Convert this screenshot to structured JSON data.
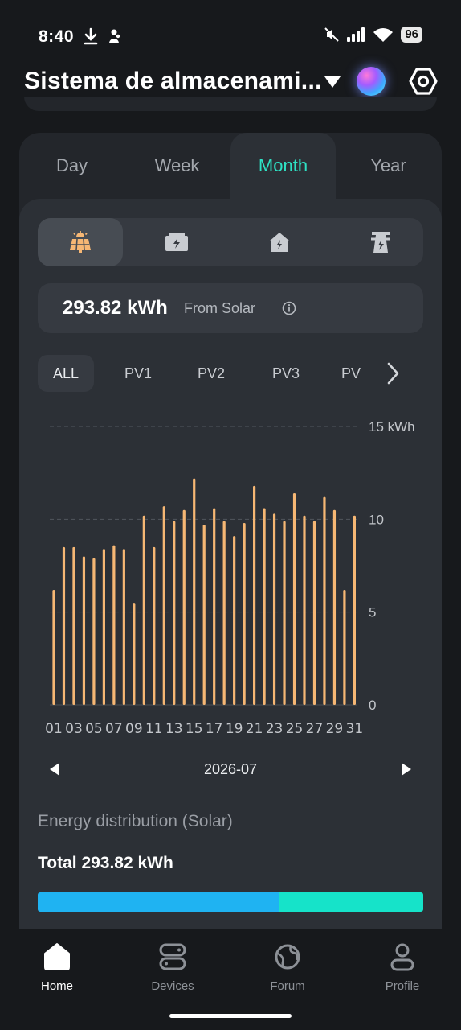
{
  "status": {
    "time": "8:40",
    "battery": "96"
  },
  "header": {
    "title": "Sistema de almacenami..."
  },
  "period_tabs": [
    {
      "label": "Day"
    },
    {
      "label": "Week"
    },
    {
      "label": "Month"
    },
    {
      "label": "Year"
    }
  ],
  "active_period": "Month",
  "source_tabs": [
    "solar-panel-icon",
    "battery-icon",
    "home-icon",
    "grid-tower-icon"
  ],
  "summary": {
    "value": "293.82 kWh",
    "label": "From Solar"
  },
  "pv_tabs": [
    {
      "label": "ALL"
    },
    {
      "label": "PV1"
    },
    {
      "label": "PV2"
    },
    {
      "label": "PV3"
    },
    {
      "label": "PV"
    }
  ],
  "chart_data": {
    "type": "bar",
    "ylabel": "kWh",
    "ylim": [
      0,
      15
    ],
    "yticks": [
      "15 kWh",
      "10",
      "5",
      "0"
    ],
    "grid": true,
    "color": "#f6b774",
    "x_tick_labels": [
      "01",
      "03",
      "05",
      "07",
      "09",
      "11",
      "13",
      "15",
      "17",
      "19",
      "21",
      "23",
      "25",
      "27",
      "29",
      "31"
    ],
    "categories": [
      "01",
      "02",
      "03",
      "04",
      "05",
      "06",
      "07",
      "08",
      "09",
      "10",
      "11",
      "12",
      "13",
      "14",
      "15",
      "16",
      "17",
      "18",
      "19",
      "20",
      "21",
      "22",
      "23",
      "24",
      "25",
      "26",
      "27",
      "28",
      "29",
      "30",
      "31"
    ],
    "values": [
      6.2,
      8.5,
      8.5,
      8.0,
      7.9,
      8.4,
      8.6,
      8.4,
      5.5,
      10.2,
      8.5,
      10.7,
      9.9,
      10.5,
      12.2,
      9.7,
      10.6,
      9.9,
      9.1,
      9.8,
      11.8,
      10.6,
      10.3,
      9.9,
      11.4,
      10.2,
      9.9,
      11.2,
      10.5,
      6.2,
      10.2
    ]
  },
  "month_nav": {
    "label": "2026-07"
  },
  "distribution": {
    "title": "Energy distribution (Solar)",
    "total": "Total 293.82 kWh",
    "segments": [
      {
        "fraction": 0.625,
        "color": "#1fb3f2"
      },
      {
        "fraction": 0.375,
        "color": "#16e3c9"
      }
    ]
  },
  "bottom_nav": [
    {
      "label": "Home",
      "icon": "home-icon",
      "active": true
    },
    {
      "label": "Devices",
      "icon": "devices-icon",
      "active": false
    },
    {
      "label": "Forum",
      "icon": "forum-globe-icon",
      "active": false
    },
    {
      "label": "Profile",
      "icon": "profile-icon",
      "active": false
    }
  ]
}
